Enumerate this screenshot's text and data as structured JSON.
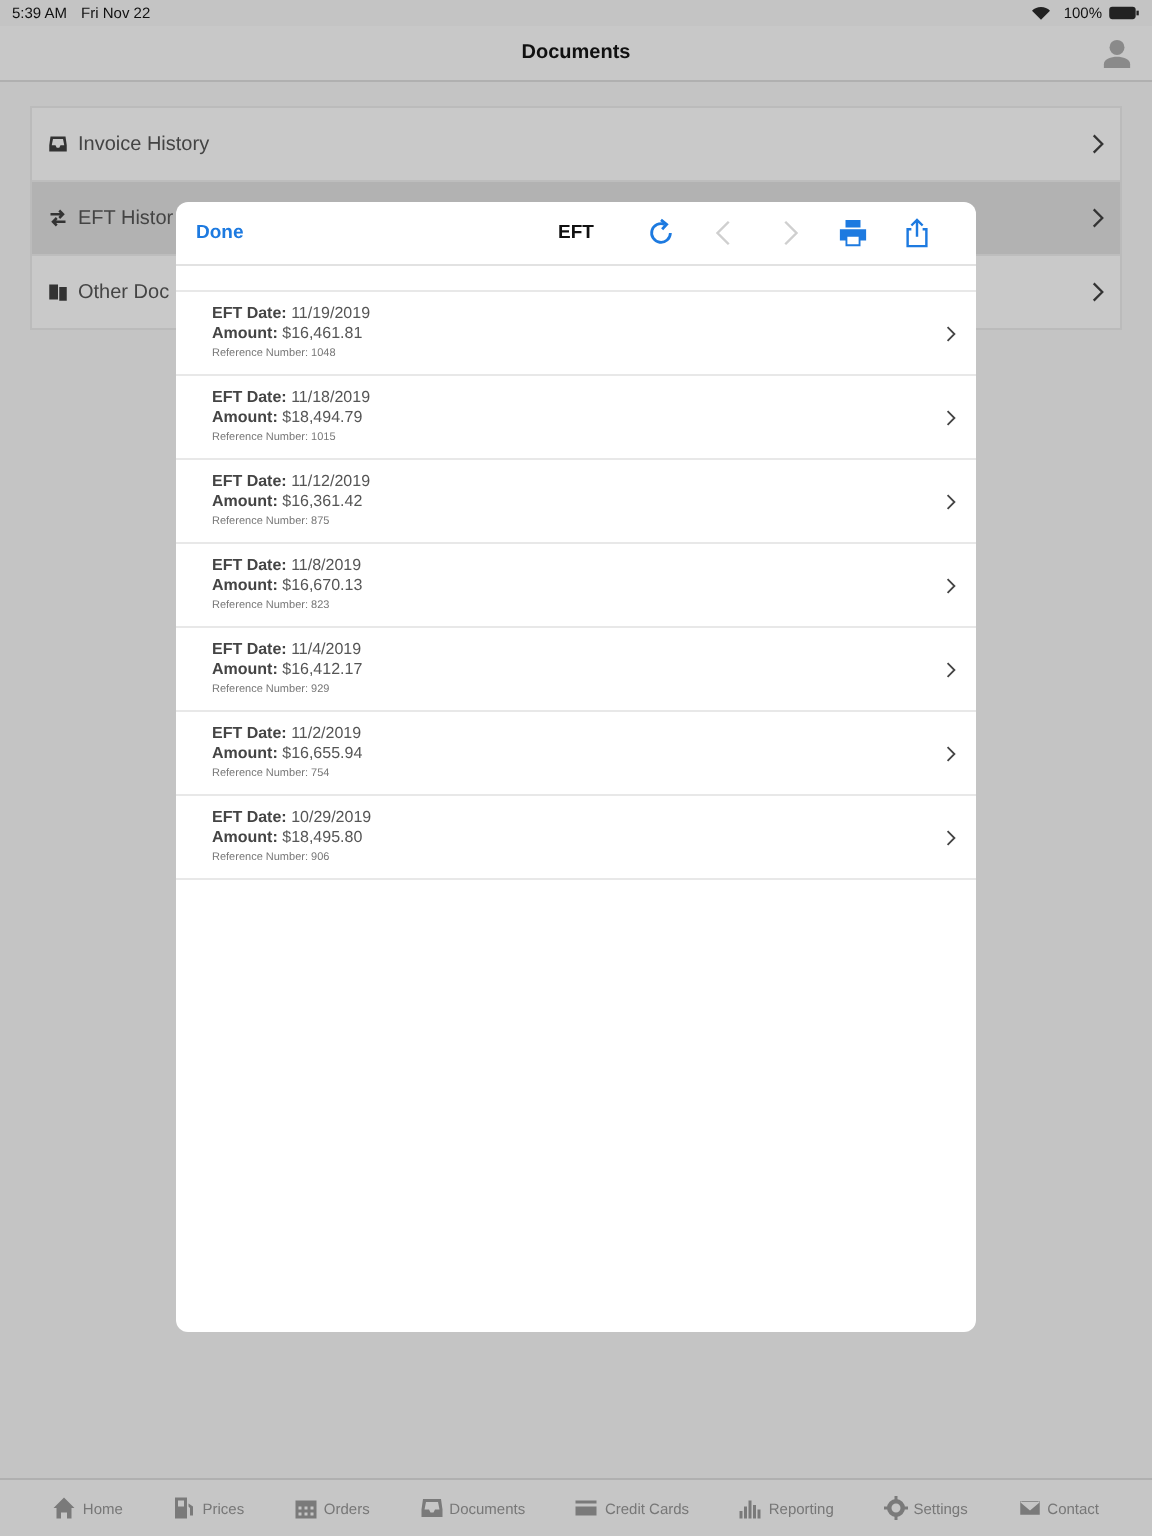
{
  "status_bar": {
    "time": "5:39 AM",
    "date": "Fri Nov 22",
    "battery": "100%"
  },
  "nav": {
    "title": "Documents"
  },
  "menu": [
    {
      "label": "Invoice History",
      "kind": "inbox",
      "selected": false
    },
    {
      "label": "EFT Histor",
      "kind": "transfer",
      "selected": true
    },
    {
      "label": "Other Doc",
      "kind": "docs",
      "selected": false
    }
  ],
  "modal": {
    "done": "Done",
    "title": "EFT",
    "toolbar": [
      {
        "kind": "refresh",
        "disabled": false
      },
      {
        "kind": "back",
        "disabled": true
      },
      {
        "kind": "forward",
        "disabled": true
      },
      {
        "kind": "print",
        "disabled": false
      },
      {
        "kind": "share",
        "disabled": false
      }
    ],
    "rows": [
      {
        "date": "**EFT Date:** 11/19/2019",
        "amount": "**Amount:** $16,461.81",
        "reference": "Reference Number: 1048"
      },
      {
        "date": "**EFT Date:** 11/18/2019",
        "amount": "**Amount:** $18,494.79",
        "reference": "Reference Number: 1015"
      },
      {
        "date": "**EFT Date:** 11/12/2019",
        "amount": "**Amount:** $16,361.42",
        "reference": "Reference Number: 875"
      },
      {
        "date": "**EFT Date:** 11/8/2019",
        "amount": "**Amount:** $16,670.13",
        "reference": "Reference Number: 823"
      },
      {
        "date": "**EFT Date:** 11/4/2019",
        "amount": "**Amount:** $16,412.17",
        "reference": "Reference Number: 929"
      },
      {
        "date": "**EFT Date:** 11/2/2019",
        "amount": "**Amount:** $16,655.94",
        "reference": "Reference Number: 754"
      },
      {
        "date": "**EFT Date:** 10/29/2019",
        "amount": "**Amount:** $18,495.80",
        "reference": "Reference Number: 906"
      }
    ]
  },
  "tab_bar": [
    {
      "label": "Home",
      "kind": "home"
    },
    {
      "label": "Prices",
      "kind": "pump"
    },
    {
      "label": "Orders",
      "kind": "calendar"
    },
    {
      "label": "Documents",
      "kind": "inbox"
    },
    {
      "label": "Credit Cards",
      "kind": "card"
    },
    {
      "label": "Reporting",
      "kind": "bars"
    },
    {
      "label": "Settings",
      "kind": "gear"
    },
    {
      "label": "Contact",
      "kind": "mail"
    }
  ]
}
